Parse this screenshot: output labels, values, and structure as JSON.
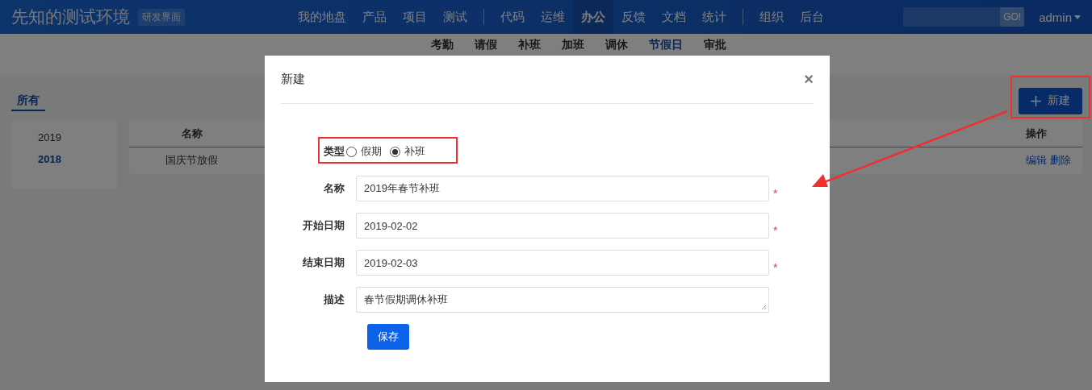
{
  "header": {
    "brand": "先知的测试环境",
    "badge": "研发界面",
    "nav_groups": [
      [
        {
          "label": "我的地盘",
          "selected": false
        },
        {
          "label": "产品",
          "selected": false
        },
        {
          "label": "项目",
          "selected": false
        },
        {
          "label": "测试",
          "selected": false
        }
      ],
      [
        {
          "label": "代码",
          "selected": false
        },
        {
          "label": "运维",
          "selected": false
        },
        {
          "label": "办公",
          "selected": true
        },
        {
          "label": "反馈",
          "selected": false
        },
        {
          "label": "文档",
          "selected": false
        },
        {
          "label": "统计",
          "selected": false
        }
      ],
      [
        {
          "label": "组织",
          "selected": false
        },
        {
          "label": "后台",
          "selected": false
        }
      ]
    ],
    "search_button": "GO!",
    "user": "admin"
  },
  "subnav": [
    {
      "label": "考勤",
      "selected": false
    },
    {
      "label": "请假",
      "selected": false
    },
    {
      "label": "补班",
      "selected": false
    },
    {
      "label": "加班",
      "selected": false
    },
    {
      "label": "调休",
      "selected": false
    },
    {
      "label": "节假日",
      "selected": true
    },
    {
      "label": "审批",
      "selected": false
    }
  ],
  "filter_tabs": [
    {
      "label": "所有",
      "selected": true
    }
  ],
  "new_button": "新建",
  "years": [
    {
      "label": "2019",
      "selected": false
    },
    {
      "label": "2018",
      "selected": true
    }
  ],
  "table": {
    "columns": [
      "名称",
      "操作"
    ],
    "rows": [
      {
        "name": "国庆节放假",
        "actions": [
          "编辑",
          "删除"
        ]
      }
    ]
  },
  "modal": {
    "title": "新建",
    "close": "×",
    "fields": [
      {
        "kind": "radio",
        "label": "类型",
        "options": [
          {
            "label": "假期",
            "selected": false
          },
          {
            "label": "补班",
            "selected": true
          }
        ]
      },
      {
        "kind": "text",
        "label": "名称",
        "value": "2019年春节补班",
        "required_mark": "*"
      },
      {
        "kind": "text",
        "label": "开始日期",
        "value": "2019-02-02",
        "required_mark": "*"
      },
      {
        "kind": "text",
        "label": "结束日期",
        "value": "2019-02-03",
        "required_mark": "*"
      },
      {
        "kind": "textarea",
        "label": "描述",
        "value": "春节假期调休补班"
      }
    ],
    "save_button": "保存"
  }
}
